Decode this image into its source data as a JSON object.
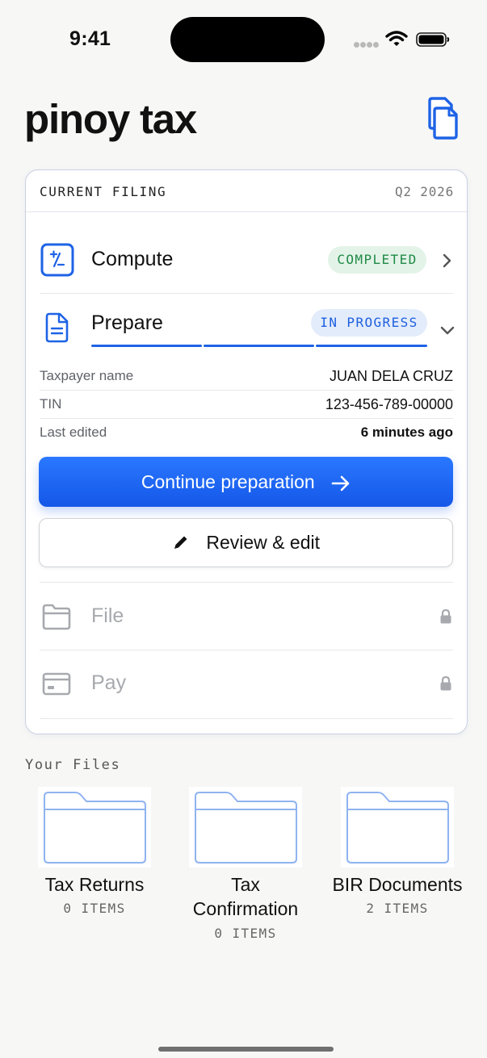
{
  "status_bar": {
    "time": "9:41"
  },
  "app": {
    "title": "pinoy tax",
    "docs_icon": "documents-icon"
  },
  "current_filing": {
    "label": "CURRENT FILING",
    "period": "Q2 2026",
    "steps": {
      "compute": {
        "title": "Compute",
        "status": "COMPLETED",
        "icon": "calculator-icon"
      },
      "prepare": {
        "title": "Prepare",
        "status": "IN PROGRESS",
        "icon": "document-icon"
      },
      "file": {
        "title": "File",
        "icon": "folder-icon",
        "locked": true
      },
      "pay": {
        "title": "Pay",
        "icon": "credit-card-icon",
        "locked": true
      }
    },
    "details": [
      {
        "label": "Taxpayer name",
        "value": "JUAN DELA CRUZ"
      },
      {
        "label": "TIN",
        "value": "123-456-789-00000"
      },
      {
        "label": "Last edited",
        "value": "6 minutes ago"
      }
    ],
    "primary_action": "Continue preparation",
    "secondary_action": "Review & edit"
  },
  "files": {
    "title": "Your Files",
    "folders": [
      {
        "name": "Tax Returns",
        "count": "0 ITEMS"
      },
      {
        "name_line1": "Tax",
        "name_line2": "Confirmation",
        "count": "0 ITEMS"
      },
      {
        "name": "BIR Documents",
        "count": "2 ITEMS"
      }
    ]
  },
  "colors": {
    "accent": "#1e63e6",
    "completed": "#1f8a46",
    "muted": "#a7a9ae"
  }
}
